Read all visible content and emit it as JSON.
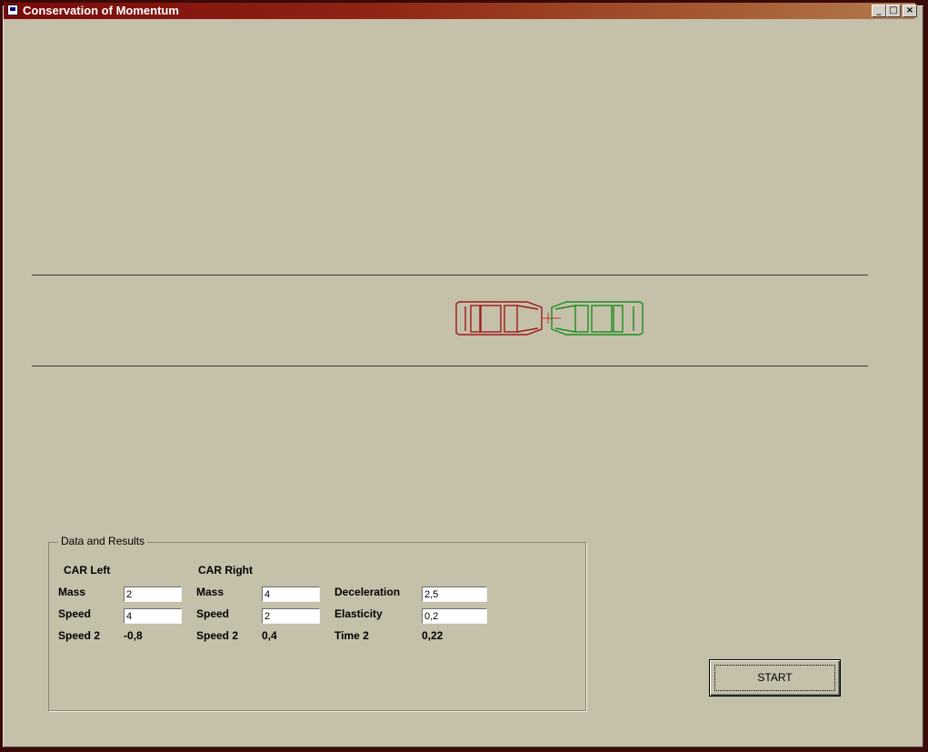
{
  "window": {
    "title": "Conservation of Momentum"
  },
  "titlebar_buttons": {
    "minimize": "_",
    "maximize": "□",
    "close": "×"
  },
  "colors": {
    "car_left": "#9c1c1c",
    "car_right": "#1e8c1e",
    "title_start": "#7a0a0a",
    "title_end": "#b47a4e",
    "background": "#c5c0aa"
  },
  "data_panel": {
    "title": "Data and Results",
    "car_left": {
      "heading": "CAR Left",
      "mass_label": "Mass",
      "mass_value": "2",
      "speed_label": "Speed",
      "speed_value": "4",
      "speed2_label": "Speed 2",
      "speed2_value": "-0,8"
    },
    "car_right": {
      "heading": "CAR Right",
      "mass_label": "Mass",
      "mass_value": "4",
      "speed_label": "Speed",
      "speed_value": "2",
      "speed2_label": "Speed 2",
      "speed2_value": "0,4"
    },
    "params": {
      "deceleration_label": "Deceleration",
      "deceleration_value": "2,5",
      "elasticity_label": "Elasticity",
      "elasticity_value": "0,2",
      "time2_label": "Time 2",
      "time2_value": "0,22"
    }
  },
  "start_button": {
    "label": "START"
  }
}
